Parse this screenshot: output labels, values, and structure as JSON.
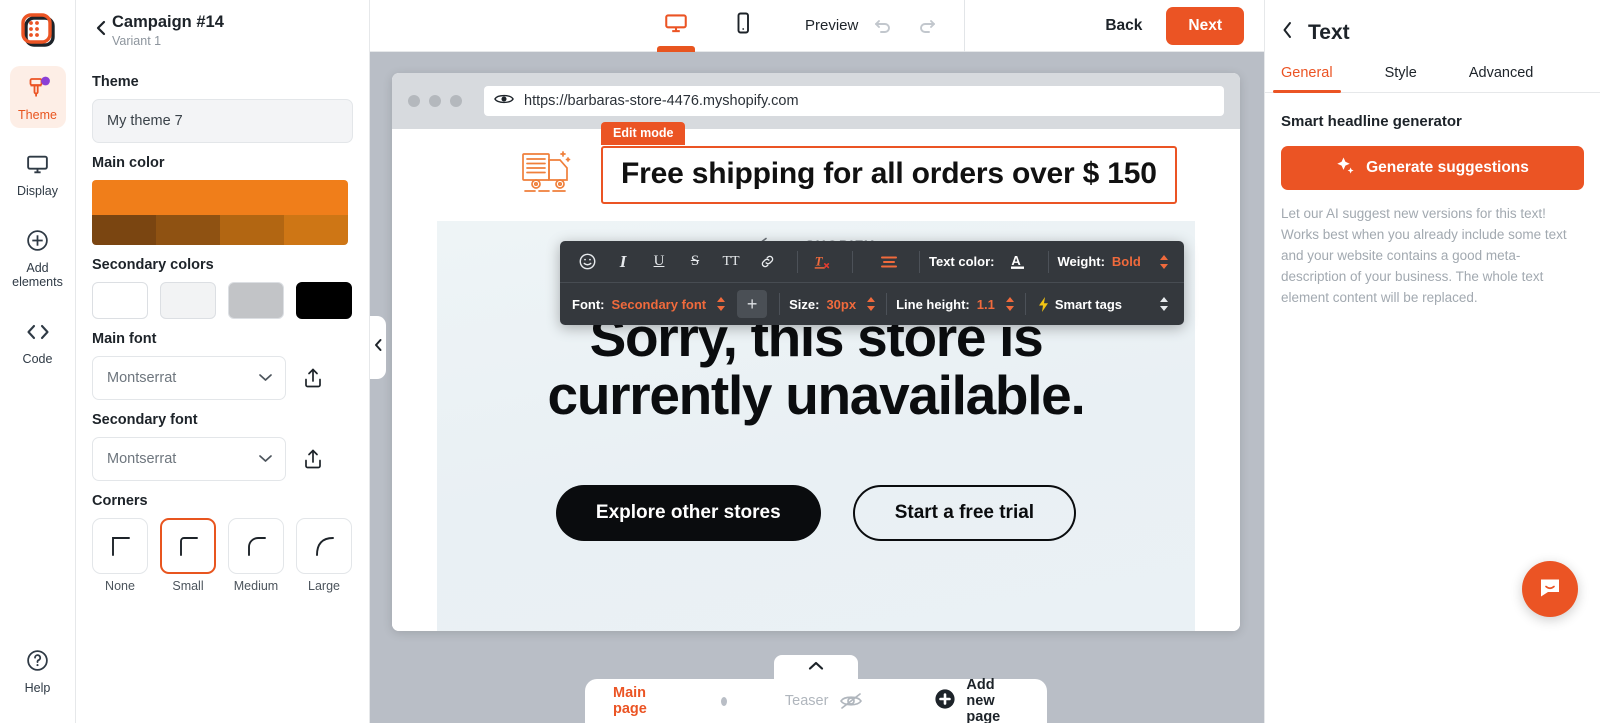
{
  "rail": {
    "logo_icon": "app-grid-logo",
    "items": [
      {
        "label": "Theme",
        "icon": "paint-brush-icon",
        "active": true
      },
      {
        "label": "Display",
        "icon": "monitor-icon",
        "active": false
      },
      {
        "label": "Add elements",
        "icon": "plus-circle-icon",
        "active": false
      },
      {
        "label": "Code",
        "icon": "code-brackets-icon",
        "active": false
      }
    ],
    "help": {
      "label": "Help",
      "icon": "question-circle-icon"
    }
  },
  "panel": {
    "title": "Campaign #14",
    "subtitle": "Variant 1",
    "back_icon": "chevron-left-icon",
    "theme": {
      "label": "Theme",
      "value": "My theme 7"
    },
    "main_color": {
      "label": "Main color",
      "top": "#F07E1A",
      "shades": [
        "#7A4511",
        "#8F5212",
        "#B26612",
        "#CE7615"
      ]
    },
    "secondary_colors": {
      "label": "Secondary colors",
      "values": [
        "#FFFFFF",
        "#F2F3F4",
        "#C2C4C7",
        "#000000"
      ]
    },
    "main_font": {
      "label": "Main font",
      "value": "Montserrat",
      "upload_icon": "upload-icon"
    },
    "secondary_font": {
      "label": "Secondary font",
      "value": "Montserrat",
      "upload_icon": "upload-icon"
    },
    "corners": {
      "label": "Corners",
      "options": [
        {
          "label": "None",
          "selected": false
        },
        {
          "label": "Small",
          "selected": true
        },
        {
          "label": "Medium",
          "selected": false
        },
        {
          "label": "Large",
          "selected": false
        }
      ]
    }
  },
  "topbar": {
    "desktop_icon": "desktop-monitor-icon",
    "mobile_icon": "mobile-phone-icon",
    "preview_label": "Preview",
    "undo_icon": "undo-arrow-icon",
    "redo_icon": "redo-arrow-icon",
    "back_label": "Back",
    "next_label": "Next",
    "accent": "#EB5424"
  },
  "stage": {
    "collapse_icon": "chevron-left-icon",
    "browser": {
      "url": "https://barbaras-store-4476.myshopify.com",
      "eye_icon": "eye-icon",
      "dots": 3
    },
    "banner": {
      "truck_icon": "delivery-truck-icon",
      "edit_badge": "Edit mode",
      "headline": "Free shipping for all orders over $ 150",
      "close_icon": "close-x-icon"
    },
    "site": {
      "brand_arrow_icon": "arrow-left-icon",
      "brand": "SHOPIFY",
      "title": "Sorry, this store is currently unavailable.",
      "primary_button": "Explore other stores",
      "secondary_button": "Start a free trial"
    },
    "toolbar": {
      "row1_icons": [
        {
          "name": "emoji-icon",
          "glyph": "☺"
        },
        {
          "name": "italic-icon",
          "glyph": "I"
        },
        {
          "name": "underline-icon",
          "glyph": "U"
        },
        {
          "name": "strikethrough-icon",
          "glyph": "S"
        },
        {
          "name": "text-transform-icon",
          "glyph": "TT"
        },
        {
          "name": "link-icon",
          "glyph": "🔗"
        },
        {
          "name": "clear-format-icon",
          "glyph": "T"
        },
        {
          "name": "align-icon",
          "glyph": "≡"
        }
      ],
      "text_color_label": "Text color:",
      "text_color_icon": "font-color-A-icon",
      "weight_label": "Weight:",
      "weight_value": "Bold",
      "font_label": "Font:",
      "font_value": "Secondary font",
      "add_font_label": "+",
      "size_label": "Size:",
      "size_value": "30px",
      "line_height_label": "Line height:",
      "line_height_value": "1.1",
      "smart_tags_label": "Smart tags",
      "smart_tags_icon": "lightning-bolt-icon",
      "stepper_icon": "stepper-up-down-icon"
    },
    "pagebar": {
      "collapse_icon": "chevron-up-icon",
      "main_page": "Main page",
      "teaser": "Teaser",
      "teaser_hidden_icon": "eye-off-icon",
      "add_page": "Add new page",
      "add_icon": "plus-circle-filled-icon"
    }
  },
  "right": {
    "back_icon": "chevron-left-icon",
    "title": "Text",
    "tabs": [
      {
        "label": "General",
        "active": true
      },
      {
        "label": "Style",
        "active": false
      },
      {
        "label": "Advanced",
        "active": false
      }
    ],
    "generator_label": "Smart headline generator",
    "generate_button": "Generate suggestions",
    "generate_icon": "sparkle-icon",
    "description": "Let our AI suggest new versions for this text! Works best when you already include some text and your website contains a good meta-description of your business. The whole text element content will be replaced."
  },
  "intercom": {
    "icon": "chat-bubble-icon"
  }
}
